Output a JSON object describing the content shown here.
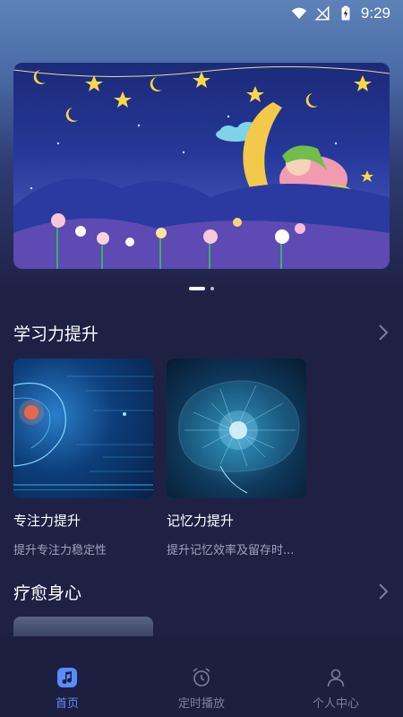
{
  "status_bar": {
    "time": "9:29"
  },
  "banner": {
    "slides": 2,
    "active_slide": 1
  },
  "sections": [
    {
      "title": "学习力提升",
      "cards": [
        {
          "title": "专注力提升",
          "subtitle": "提升专注力稳定性"
        },
        {
          "title": "记忆力提升",
          "subtitle": "提升记忆效率及留存时..."
        }
      ]
    },
    {
      "title": "疗愈身心"
    }
  ],
  "tabbar": {
    "tabs": [
      {
        "label": "首页",
        "icon": "music-note-icon",
        "active": true
      },
      {
        "label": "定时播放",
        "icon": "alarm-clock-icon",
        "active": false
      },
      {
        "label": "个人中心",
        "icon": "person-icon",
        "active": false
      }
    ]
  },
  "colors": {
    "accent": "#5b8cff",
    "background": "#1e2144",
    "tab_inactive": "#7b7f9e",
    "subtitle": "#9fa3bf"
  }
}
